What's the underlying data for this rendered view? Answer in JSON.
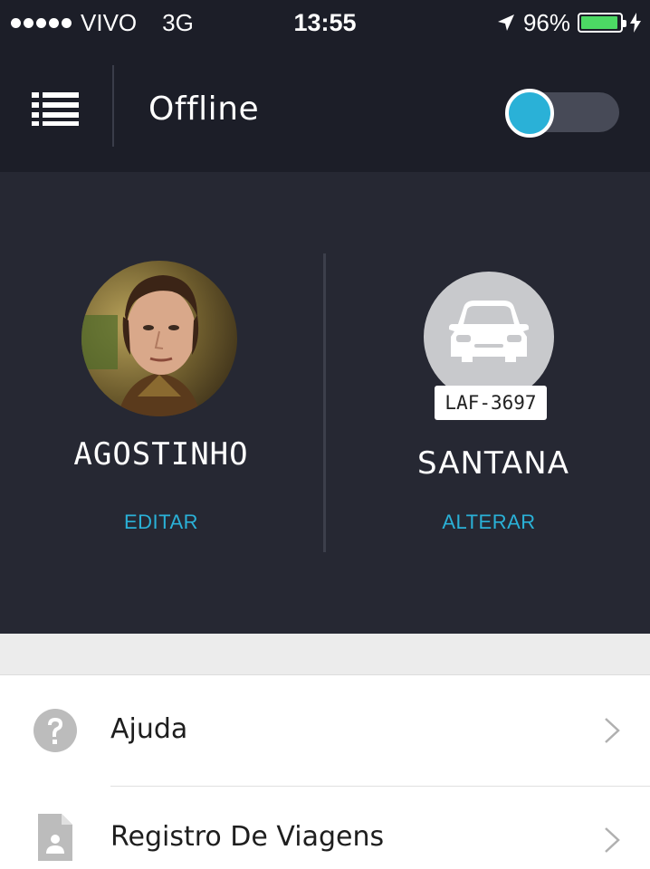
{
  "status_bar": {
    "carrier": "VIVO",
    "network": "3G",
    "time": "13:55",
    "battery": "96%",
    "battery_level": 0.96,
    "battery_color": "#4cd964"
  },
  "header": {
    "title": "Offline",
    "menu_icon": "list-menu-icon",
    "toggle_state": "off",
    "accent_color": "#2ab1d7"
  },
  "driver": {
    "name": "AGOSTINHO",
    "edit_label": "EDITAR"
  },
  "vehicle": {
    "plate": "LAF-3697",
    "model": "SANTANA",
    "change_label": "ALTERAR",
    "icon": "car-icon"
  },
  "menu": {
    "items": [
      {
        "label": "Ajuda",
        "icon": "help-icon"
      },
      {
        "label": "Registro De Viagens",
        "icon": "document-icon"
      }
    ]
  }
}
